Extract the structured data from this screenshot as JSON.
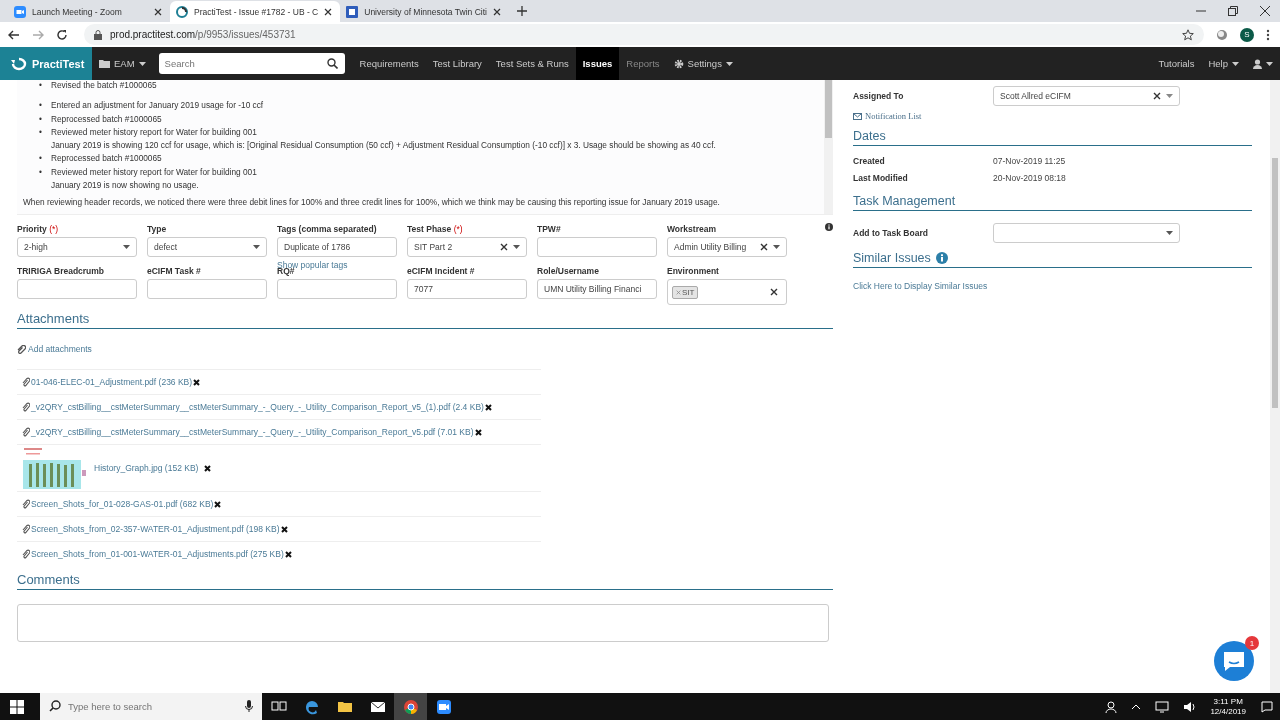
{
  "browser": {
    "tabs": [
      {
        "title": "Launch Meeting - Zoom",
        "selected": false
      },
      {
        "title": "PractiTest - Issue #1782 - UB - C",
        "selected": true
      },
      {
        "title": "University of Minnesota Twin Citi",
        "selected": false
      }
    ],
    "url_host": "prod.practitest.com",
    "url_path": "/p/9953/issues/453731",
    "profile_initial": "S"
  },
  "nav": {
    "logo": "PractiTest",
    "project": "EAM",
    "search_placeholder": "Search",
    "items": [
      {
        "label": "Requirements",
        "selected": false,
        "disabled": false
      },
      {
        "label": "Test Library",
        "selected": false,
        "disabled": false
      },
      {
        "label": "Test Sets & Runs",
        "selected": false,
        "disabled": false
      },
      {
        "label": "Issues",
        "selected": true,
        "disabled": false
      },
      {
        "label": "Reports",
        "selected": false,
        "disabled": true
      }
    ],
    "settings": "Settings",
    "right_items": [
      "Tutorials",
      "Help"
    ]
  },
  "description": {
    "bullets": [
      {
        "marker": "•",
        "text": "Revised the batch #1000065"
      },
      {
        "marker": "•",
        "text": "Entered an adjustment for January 2019 usage for -10 ccf"
      },
      {
        "marker": "•",
        "text": "Reprocessed batch #1000065"
      },
      {
        "marker": "•",
        "text": "Reviewed meter history report for Water for building 001",
        "note": "January 2019 is showing 120 ccf for usage, which is: [Original Residual Consumption (50 ccf) + Adjustment Residual Consumption (-10 ccf)] x 3. Usage should be showing as 40 ccf."
      },
      {
        "marker": "•",
        "text": "Reprocessed batch #1000065"
      },
      {
        "marker": "•",
        "text": "Reviewed meter history report for Water for building 001",
        "note": "January 2019 is now showing no usage."
      }
    ],
    "paragraph": "When reviewing header records, we noticed there were three debit lines for 100% and three credit lines for 100%, which we think may be causing this reporting issue for January 2019 usage."
  },
  "fields": [
    {
      "label": "Priority",
      "required_mark": "(*)",
      "kind": "select",
      "value": "2-high"
    },
    {
      "label": "Type",
      "kind": "select",
      "value": "defect"
    },
    {
      "label": "Tags (comma separated)",
      "kind": "text",
      "value": "Duplicate of 1786",
      "link": "Show popular tags"
    },
    {
      "label": "Test Phase",
      "required_mark": "(*)",
      "kind": "select",
      "value": "SIT Part 2",
      "clearable": true
    },
    {
      "label": "TPW#",
      "kind": "text"
    },
    {
      "label": "Workstream",
      "kind": "select",
      "value": "Admin Utility Billing",
      "clearable": true
    },
    {
      "label": "TRIRIGA Breadcrumb",
      "kind": "text"
    },
    {
      "label": "eCIFM Task #",
      "kind": "text"
    },
    {
      "label": "RQ#",
      "kind": "text"
    },
    {
      "label": "eCIFM Incident #",
      "kind": "text",
      "value": "7077"
    },
    {
      "label": "Role/Username",
      "kind": "text",
      "value": "UMN Utility Billing Financi"
    },
    {
      "label": "Environment",
      "kind": "tags",
      "tags": [
        "SIT"
      ]
    }
  ],
  "side": {
    "assigned_label": "Assigned To",
    "assigned_value": "Scott Allred eCIFM",
    "notification_link": "Notification List",
    "dates_title": "Dates",
    "dates": [
      {
        "label": "Created",
        "value": "07-Nov-2019 11:25"
      },
      {
        "label": "Last Modified",
        "value": "20-Nov-2019 08:18"
      }
    ],
    "task_title": "Task Management",
    "task_label": "Add to Task Board",
    "similar_title": "Similar Issues",
    "similar_link": "Click Here to Display Similar Issues"
  },
  "attachments": {
    "title": "Attachments",
    "add_link": "Add attachments",
    "files": [
      {
        "kind": "file",
        "name": "01-046-ELEC-01_Adjustment.pdf",
        "size": "(236 KB)"
      },
      {
        "kind": "file",
        "name": "_v2QRY_cstBilling__cstMeterSummary__cstMeterSummary_-_Query_-_Utility_Comparison_Report_v5_(1).pdf",
        "size": "(2.4 KB)"
      },
      {
        "kind": "file",
        "name": "_v2QRY_cstBilling__cstMeterSummary__cstMeterSummary_-_Query_-_Utility_Comparison_Report_v5.pdf",
        "size": "(7.01 KB)"
      },
      {
        "name": "History_Graph.jpg",
        "size": "(152 KB)"
      },
      {
        "kind": "file",
        "name": "Screen_Shots_for_01-028-GAS-01.pdf",
        "size": "(682 KB)"
      },
      {
        "kind": "file",
        "name": "Screen_Shots_from_02-357-WATER-01_Adjustment.pdf",
        "size": "(198 KB)"
      },
      {
        "kind": "file",
        "name": "Screen_Shots_from_01-001-WATER-01_Adjustments.pdf",
        "size": "(275 KB)"
      }
    ]
  },
  "comments": {
    "title": "Comments"
  },
  "chat": {
    "badge": "1"
  },
  "taskbar": {
    "search_placeholder": "Type here to search",
    "time": "3:11 PM",
    "date": "12/4/2019"
  }
}
